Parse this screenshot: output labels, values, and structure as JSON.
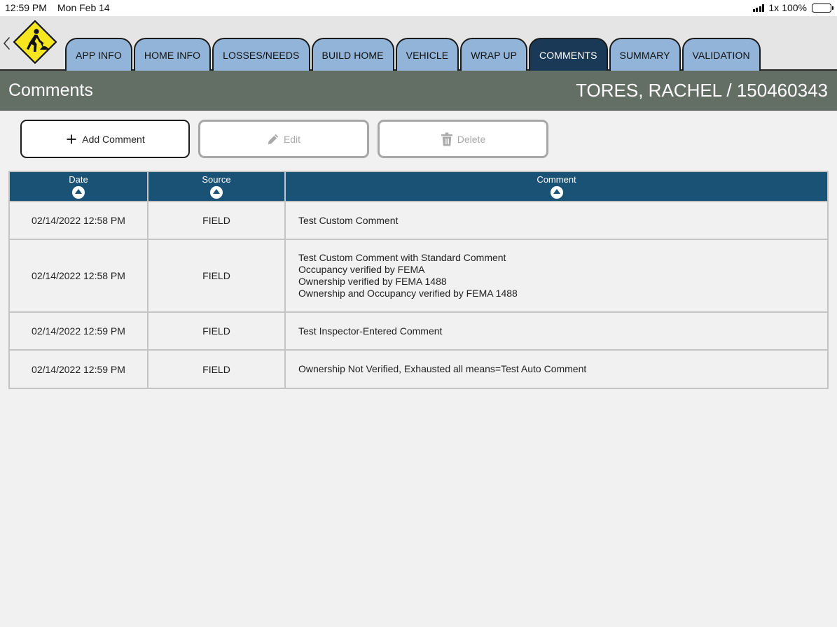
{
  "status_bar": {
    "time": "12:59 PM",
    "date": "Mon Feb 14",
    "zoom": "1x",
    "battery": "100%"
  },
  "tabs": [
    {
      "label": "APP INFO",
      "active": false
    },
    {
      "label": "HOME INFO",
      "active": false
    },
    {
      "label": "LOSSES/NEEDS",
      "active": false
    },
    {
      "label": "BUILD HOME",
      "active": false
    },
    {
      "label": "VEHICLE",
      "active": false
    },
    {
      "label": "WRAP UP",
      "active": false
    },
    {
      "label": "COMMENTS",
      "active": true
    },
    {
      "label": "SUMMARY",
      "active": false
    },
    {
      "label": "VALIDATION",
      "active": false
    }
  ],
  "header": {
    "title": "Comments",
    "record": "TORES, RACHEL / 150460343"
  },
  "toolbar": {
    "add_label": "Add Comment",
    "edit_label": "Edit",
    "delete_label": "Delete"
  },
  "table": {
    "columns": [
      "Date",
      "Source",
      "Comment"
    ],
    "rows": [
      {
        "date": "02/14/2022 12:58 PM",
        "source": "FIELD",
        "comment": [
          "Test Custom Comment"
        ]
      },
      {
        "date": "02/14/2022 12:58 PM",
        "source": "FIELD",
        "comment": [
          "Test Custom Comment with Standard Comment",
          "Occupancy verified by FEMA",
          "Ownership verified by FEMA 1488",
          "Ownership and Occupancy verified by FEMA 1488"
        ]
      },
      {
        "date": "02/14/2022 12:59 PM",
        "source": "FIELD",
        "comment": [
          "Test Inspector-Entered Comment"
        ]
      },
      {
        "date": "02/14/2022 12:59 PM",
        "source": "FIELD",
        "comment": [
          "Ownership Not Verified, Exhausted all means=Test Auto Comment"
        ]
      }
    ]
  },
  "colors": {
    "tab_inactive": "#92b4d8",
    "tab_active": "#1a3957",
    "header_bar": "#636e64",
    "table_header": "#1a5276",
    "logo_yellow": "#f5e61f"
  },
  "icons": [
    "back-chevron-icon",
    "construction-worker-icon",
    "plus-icon",
    "pencil-icon",
    "trash-icon",
    "sort-ascending-icon"
  ]
}
